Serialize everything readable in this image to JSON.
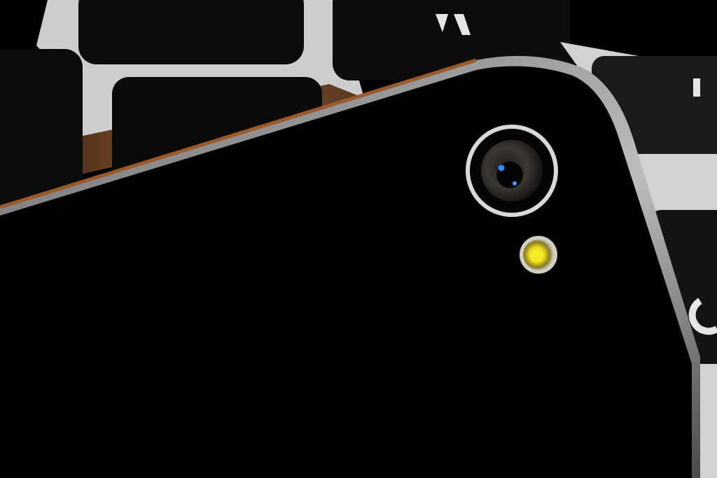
{
  "scene": {
    "subject": "phone-rear-camera-on-keyboard",
    "colors": {
      "background": "#000000",
      "keyboard_frame": "#cfcfcf",
      "key_top": "#0a0a0a",
      "warm_reflection": "#7a3c12",
      "phone_body": "#000000",
      "phone_edge": "#8a8a8a",
      "lens_ring": "#d8d8d8",
      "lens_glass": "#3a3634",
      "lens_highlight": "#2a8cff",
      "flash_yellow": "#f0e21a"
    },
    "icons": [
      "camera-lens-icon",
      "flash-led-icon"
    ]
  }
}
